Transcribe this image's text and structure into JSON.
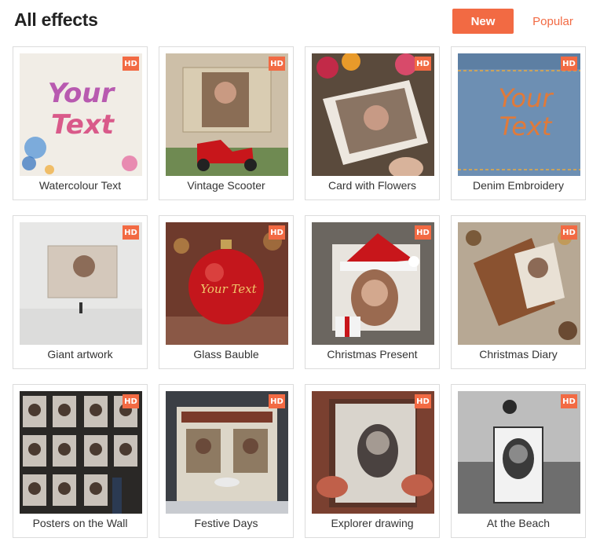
{
  "header": {
    "title": "All effects",
    "sort_new_label": "New",
    "sort_popular_label": "Popular"
  },
  "colors": {
    "accent": "#f26a43",
    "badge_text": "#ffffff"
  },
  "effects": [
    {
      "name": "Watercolour Text",
      "badge": "HD",
      "thumb_text": "Your Text"
    },
    {
      "name": "Vintage Scooter",
      "badge": "HD"
    },
    {
      "name": "Card with Flowers",
      "badge": "HD"
    },
    {
      "name": "Denim Embroidery",
      "badge": "HD",
      "thumb_text": "Your Text"
    },
    {
      "name": "Giant artwork",
      "badge": "HD"
    },
    {
      "name": "Glass Bauble",
      "badge": "HD",
      "thumb_text": "Your Text"
    },
    {
      "name": "Christmas Present",
      "badge": "HD"
    },
    {
      "name": "Christmas Diary",
      "badge": "HD"
    },
    {
      "name": "Posters on the Wall",
      "badge": "HD"
    },
    {
      "name": "Festive Days",
      "badge": "HD"
    },
    {
      "name": "Explorer drawing",
      "badge": "HD"
    },
    {
      "name": "At the Beach",
      "badge": "HD"
    }
  ]
}
